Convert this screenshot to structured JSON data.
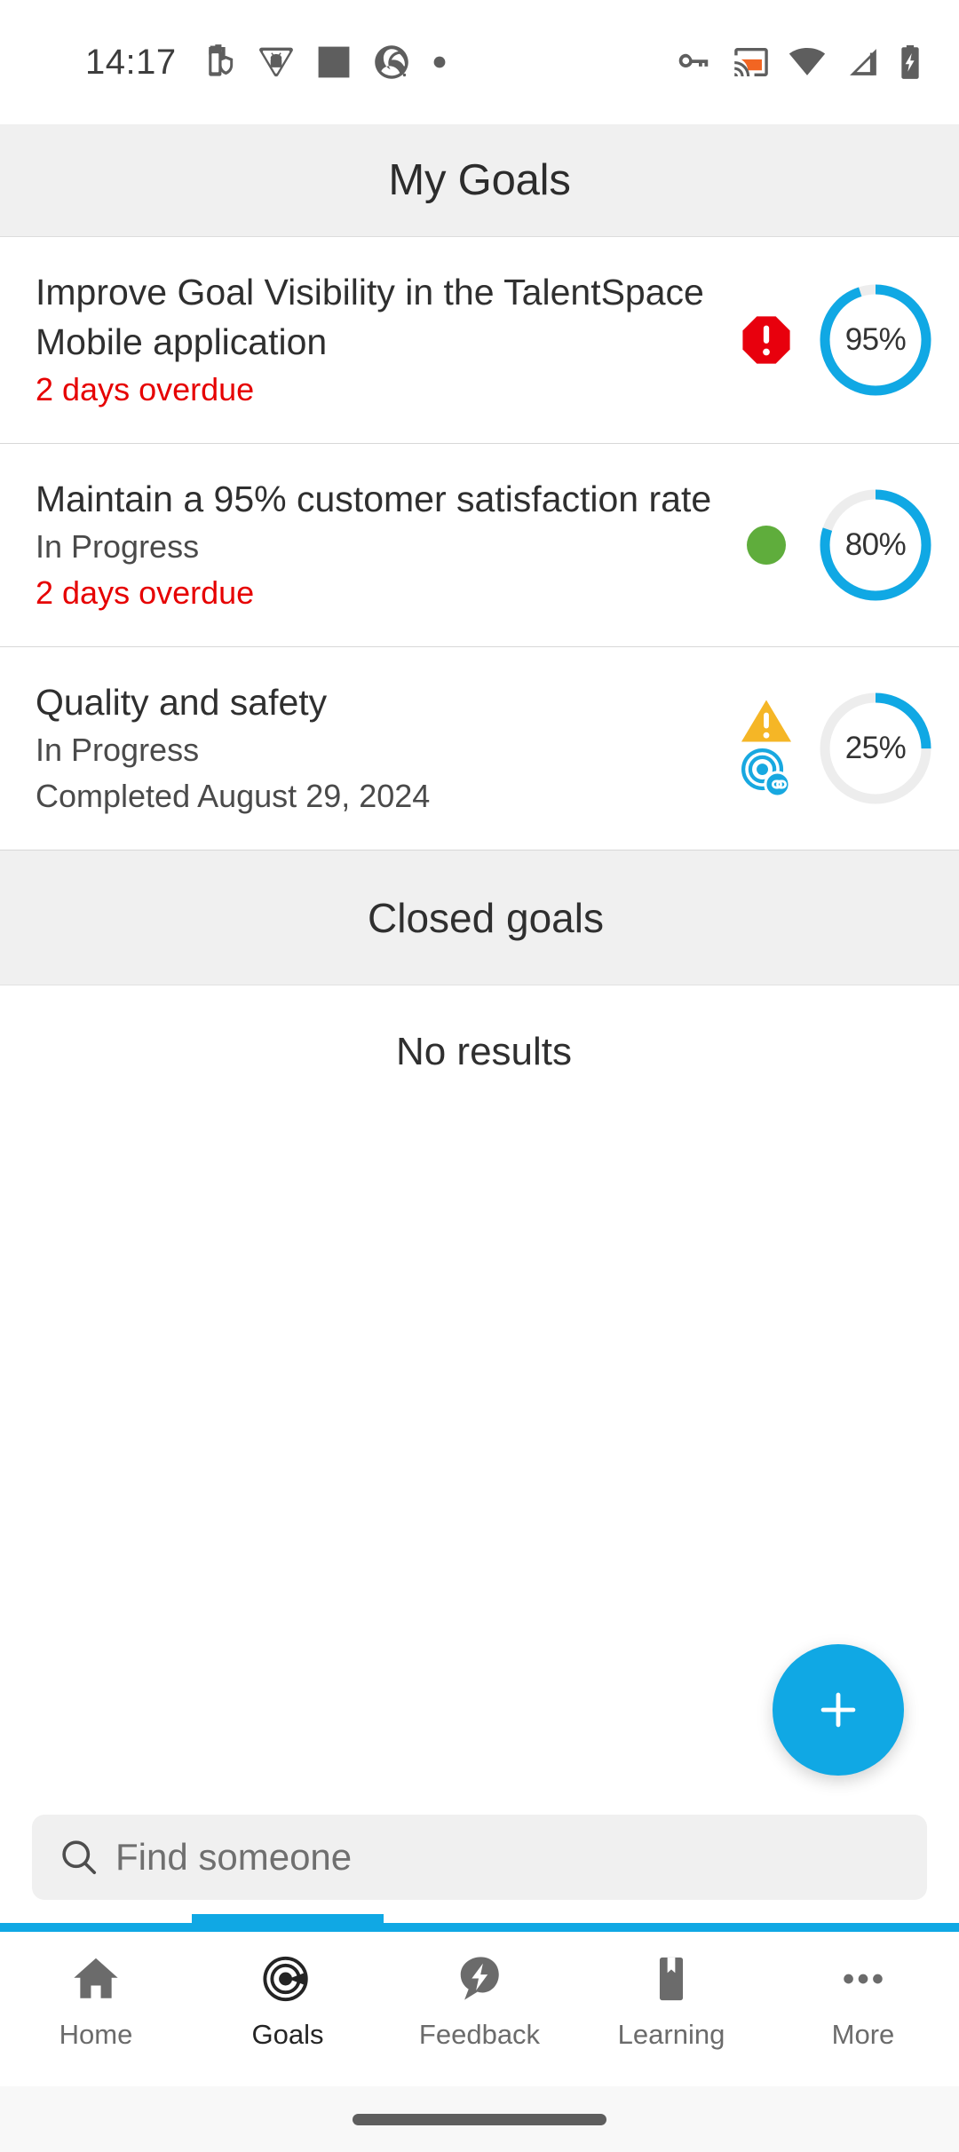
{
  "status_bar": {
    "clock": "14:17",
    "left_icons": [
      "battery-saver-icon",
      "android-triangle-icon",
      "square-icon",
      "pinwheel-icon",
      "dot-icon"
    ],
    "right_icons": [
      "vpn-key-icon",
      "cast-icon",
      "wifi-icon",
      "cellular-signal-icon",
      "battery-charging-icon"
    ],
    "colors": {
      "icon": "#5e5e5e",
      "cast_accent": "#F26522"
    }
  },
  "header": {
    "title": "My Goals",
    "background": "#f0f0f0"
  },
  "goals": {
    "items": [
      {
        "title": "Improve Goal Visibility in the TalentSpace Mobile application",
        "status": "",
        "due": "2 days overdue",
        "percent": 95,
        "percent_label": "95%",
        "badge": "alert-octagon-icon",
        "badge_color": "#E8000D",
        "ring_color": "#10A8E4",
        "track_color": "#EDEDED"
      },
      {
        "title": "Maintain a 95% customer satisfaction rate",
        "status": "In Progress",
        "due": "2 days overdue",
        "percent": 80,
        "percent_label": "80%",
        "badge": "status-dot-icon",
        "badge_color": "#5FAD3C",
        "ring_color": "#10A8E4",
        "track_color": "#EDEDED"
      },
      {
        "title": "Quality and safety",
        "status": "In Progress",
        "due": "Completed August 29, 2024",
        "due_color": "#4a4a4a",
        "percent": 25,
        "percent_label": "25%",
        "badge": "warning-triangle-icon",
        "badge_color": "#F5B626",
        "badge2": "linked-target-icon",
        "badge2_color": "#18A8E0",
        "ring_color": "#10A8E4",
        "track_color": "#EDEDED"
      }
    ]
  },
  "closed_section": {
    "title": "Closed goals",
    "empty_text": "No results"
  },
  "fab": {
    "icon": "plus-icon",
    "color": "#10A8E4"
  },
  "search": {
    "icon": "search-icon",
    "placeholder": "Find someone",
    "value": ""
  },
  "bottom_nav": {
    "active_index": 1,
    "accent": "#10A8E4",
    "items": [
      {
        "label": "Home",
        "icon": "home-icon"
      },
      {
        "label": "Goals",
        "icon": "target-icon"
      },
      {
        "label": "Feedback",
        "icon": "feedback-bolt-icon"
      },
      {
        "label": "Learning",
        "icon": "bookmark-book-icon"
      },
      {
        "label": "More",
        "icon": "more-dots-icon"
      }
    ]
  }
}
